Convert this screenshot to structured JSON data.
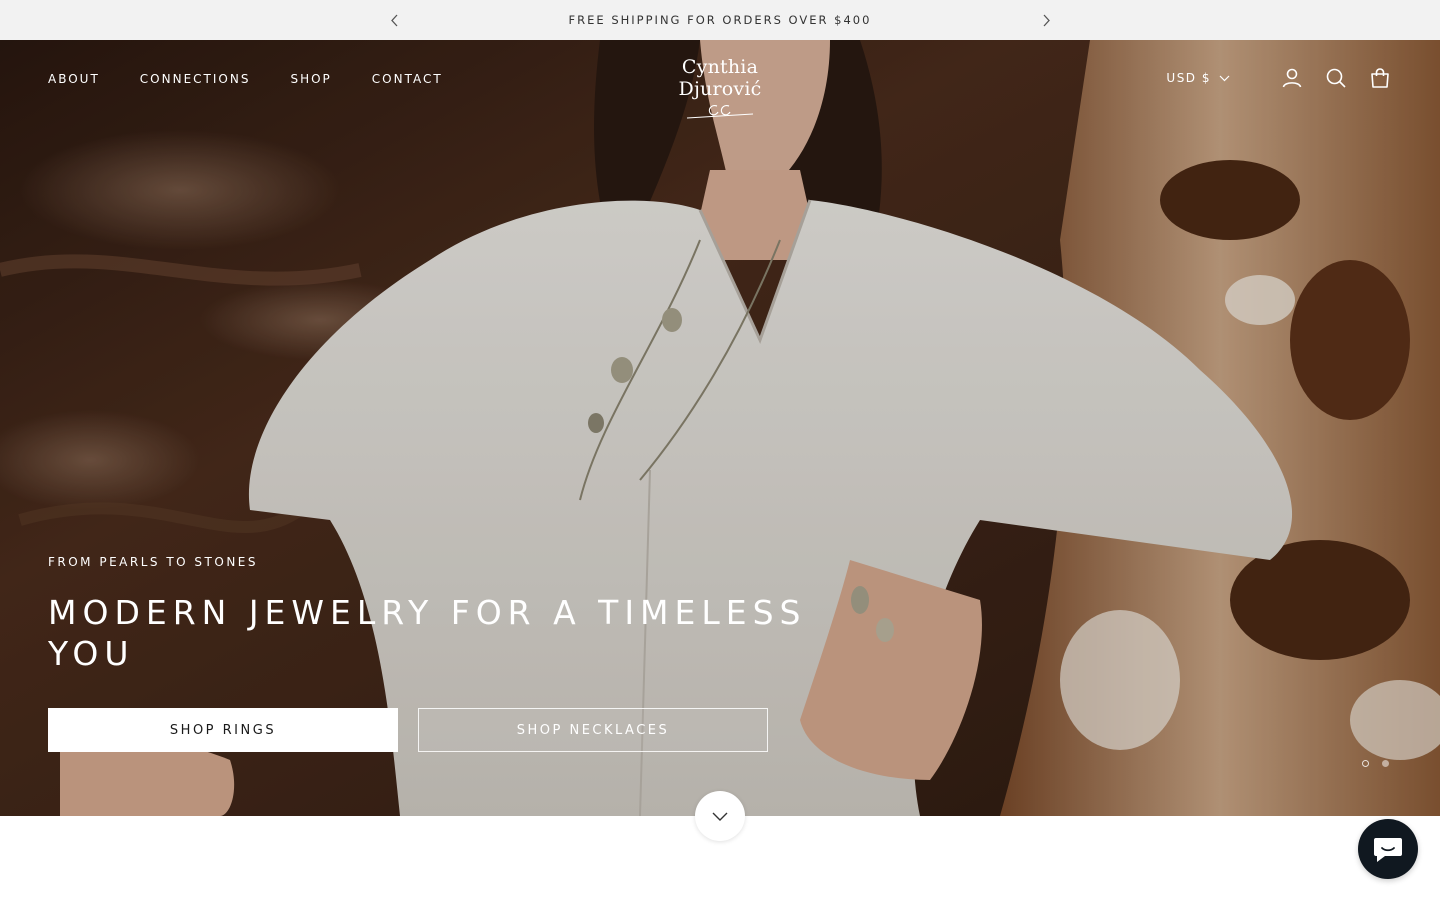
{
  "announcement": {
    "text": "FREE SHIPPING FOR ORDERS OVER $400",
    "prev_icon": "chevron-left-icon",
    "next_icon": "chevron-right-icon"
  },
  "header": {
    "nav": [
      {
        "label": "ABOUT"
      },
      {
        "label": "CONNECTIONS"
      },
      {
        "label": "SHOP"
      },
      {
        "label": "CONTACT"
      }
    ],
    "logo": "Cynthia Djurović",
    "currency": "USD $",
    "icons": [
      "account-icon",
      "search-icon",
      "bag-icon"
    ]
  },
  "hero": {
    "subtitle": "FROM PEARLS TO STONES",
    "title": "MODERN JEWELRY FOR A TIMELESS YOU",
    "primary_button": "SHOP RINGS",
    "secondary_button": "SHOP NECKLACES",
    "slides_total": 2,
    "slide_active": 1
  },
  "colors": {
    "announcement_bg": "#f2f2f2",
    "chat_bg": "#101820",
    "text_light": "#ffffff"
  }
}
